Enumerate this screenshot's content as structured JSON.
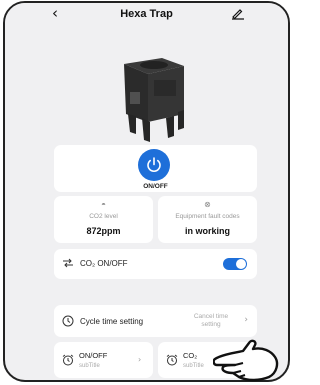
{
  "header": {
    "title": "Hexa Trap",
    "back_icon": "chevron-left-icon",
    "edit_icon": "pencil-icon"
  },
  "power": {
    "label": "ON/OFF",
    "color": "#1e6fd9"
  },
  "stats": [
    {
      "icon": "co2-level-icon",
      "label": "CO2 level",
      "value": "872ppm"
    },
    {
      "icon": "fault-code-icon",
      "label": "Equipment fault codes",
      "value": "in working"
    }
  ],
  "co2_switch": {
    "label": "CO₂ ON/OFF",
    "state": "on"
  },
  "cycle": {
    "label": "Cycle time setting",
    "action": "Cancel time setting"
  },
  "schedules": [
    {
      "title": "ON/OFF",
      "subtitle": "subTitle"
    },
    {
      "title": "CO₂",
      "subtitle": "subTitle"
    }
  ]
}
